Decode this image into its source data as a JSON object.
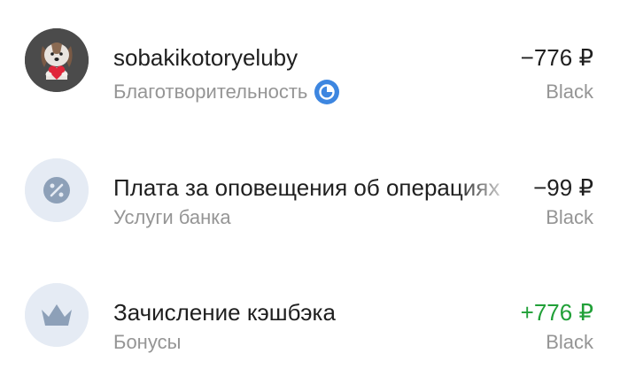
{
  "transactions": [
    {
      "title": "sobakikotoryeluby",
      "category": "Благотворительность",
      "amount": "−776 ₽",
      "card": "Black",
      "icon": "dog-with-heart-avatar",
      "badge_icon": "charity-pie-icon"
    },
    {
      "title": "Плата за оповещения об операциях",
      "category": "Услуги банка",
      "amount": "−99 ₽",
      "card": "Black",
      "icon": "percent-icon"
    },
    {
      "title": "Зачисление кэшбэка",
      "category": "Бонусы",
      "amount": "+776 ₽",
      "card": "Black",
      "icon": "crown-icon"
    }
  ],
  "colors": {
    "text_primary": "#1f1f1f",
    "text_secondary": "#959595",
    "amount_positive": "#21a038",
    "icon_bg": "#e5ebf4",
    "icon_fg": "#8da0b8",
    "badge_blue": "#3d86e0"
  }
}
